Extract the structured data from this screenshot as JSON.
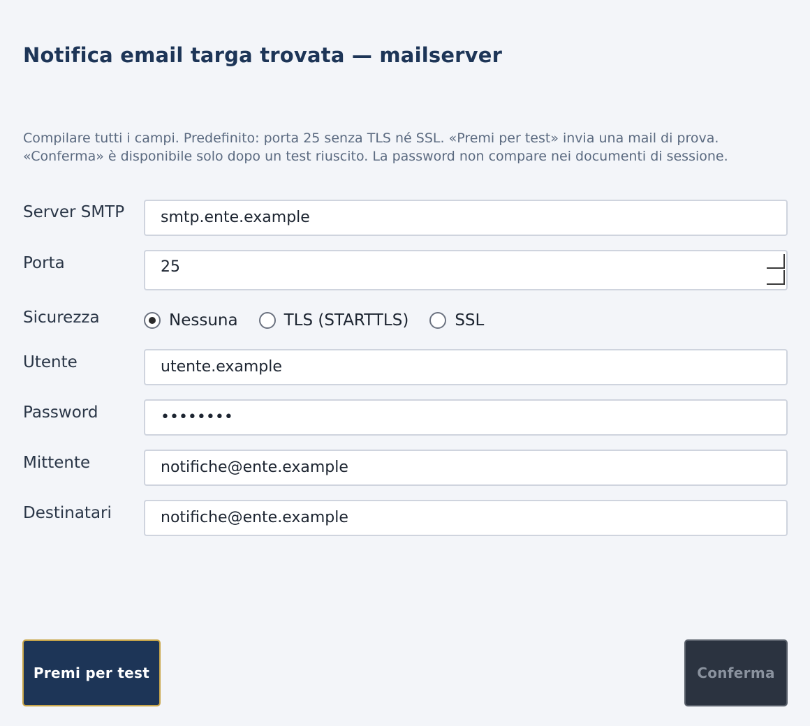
{
  "window": {
    "title": "Notifica email targa trovata — mailserver"
  },
  "intro": {
    "line1": "Compilare tutti i campi. Predefinito: porta 25 senza TLS né SSL. «Premi per test» invia una mail di prova.",
    "line2": "«Conferma» è disponibile solo dopo un test riuscito. La password non compare nei documenti di sessione."
  },
  "form": {
    "server": {
      "label": "Server SMTP",
      "value": "smtp.ente.example"
    },
    "port": {
      "label": "Porta",
      "value": "25"
    },
    "security": {
      "label": "Sicurezza",
      "options": [
        "Nessuna",
        "TLS (STARTTLS)",
        "SSL"
      ],
      "selected": "Nessuna"
    },
    "user": {
      "label": "Utente",
      "value": "utente.example"
    },
    "password": {
      "label": "Password",
      "value": "••••••••"
    },
    "sender": {
      "label": "Mittente",
      "value": "notifiche@ente.example"
    },
    "recipients": {
      "label": "Destinatari",
      "value": "notifiche@ente.example"
    }
  },
  "actions": {
    "test_label": "Premi per test",
    "confirm_label": "Conferma"
  },
  "colors": {
    "title": "#1d3557",
    "test_button_bg": "#1d3557",
    "test_button_border": "#c9a64a",
    "confirm_button_bg": "#2b3340"
  }
}
